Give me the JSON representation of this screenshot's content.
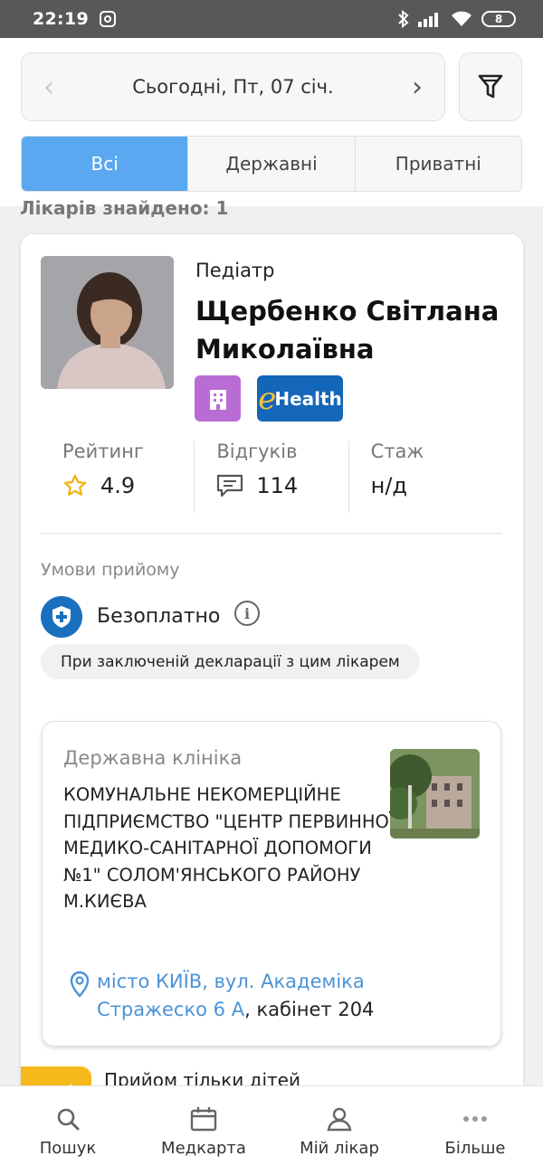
{
  "status_bar": {
    "time": "22:19",
    "battery": "8"
  },
  "header": {
    "date_label": "Сьогодні, Пт, 07 січ.",
    "tabs": [
      {
        "label": "Всі",
        "active": true
      },
      {
        "label": "Державні",
        "active": false
      },
      {
        "label": "Приватні",
        "active": false
      }
    ]
  },
  "results_count": "Лікарів знайдено: 1",
  "doctor": {
    "specialty": "Педіатр",
    "name": "Щербенко Світлана Миколаївна",
    "badges": [
      "hospital-icon",
      "ehealth-badge"
    ],
    "ehealth_e": "e",
    "ehealth_text": "Health",
    "stats": {
      "rating_label": "Рейтинг",
      "rating_value": "4.9",
      "reviews_label": "Відгуків",
      "reviews_value": "114",
      "experience_label": "Стаж",
      "experience_value": "н/д"
    },
    "conditions_title": "Умови прийому",
    "price": "Безоплатно",
    "condition_note": "При заключеній декларації з цим лікарем"
  },
  "clinic": {
    "type": "Державна клініка",
    "name": "КОМУНАЛЬНЕ НЕКОМЕРЦІЙНЕ ПІДПРИЄМСТВО \"ЦЕНТР ПЕРВИННОЇ МЕДИКО-САНІТАРНОЇ ДОПОМОГИ №1\" СОЛОМ'ЯНСЬКОГО РАЙОНУ М.КИЄВА",
    "address_link": "місто КИЇВ, вул. Академіка Стражеско 6 А",
    "address_suffix": ", кабінет 204"
  },
  "kids_only": "Прийом тільки дітей",
  "bottom_nav": [
    {
      "label": "Пошук",
      "icon": "search-icon"
    },
    {
      "label": "Медкарта",
      "icon": "calendar-icon"
    },
    {
      "label": "Мій лікар",
      "icon": "user-icon"
    },
    {
      "label": "Більше",
      "icon": "more-icon"
    }
  ],
  "colors": {
    "accent": "#5aa8ef",
    "status_bar": "#585858",
    "badge_purple": "#b86cd4",
    "ehealth_blue": "#1466b8",
    "shield_blue": "#1a6fbf",
    "link": "#4b93d6",
    "kids_yellow": "#f5b919"
  }
}
